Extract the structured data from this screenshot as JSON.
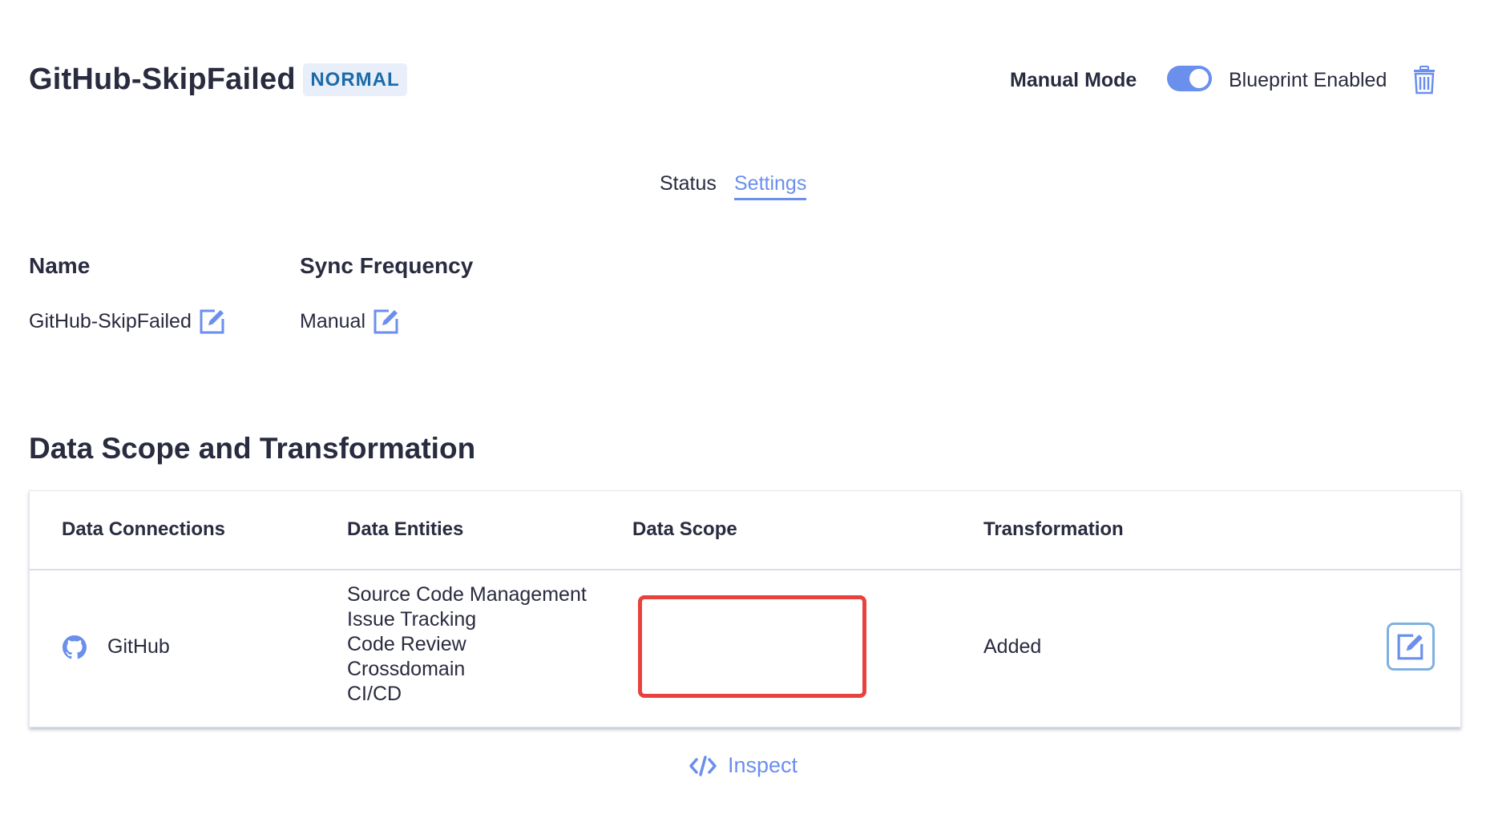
{
  "header": {
    "title": "GitHub-SkipFailed",
    "status_badge": "NORMAL",
    "manual_mode_label": "Manual Mode",
    "blueprint_toggle_on": true,
    "blueprint_label": "Blueprint Enabled"
  },
  "tabs": [
    {
      "label": "Status",
      "active": false
    },
    {
      "label": "Settings",
      "active": true
    }
  ],
  "settings": {
    "name_label": "Name",
    "name_value": "GitHub-SkipFailed",
    "sync_label": "Sync Frequency",
    "sync_value": "Manual"
  },
  "section": {
    "title": "Data Scope and Transformation"
  },
  "table": {
    "headers": [
      "Data Connections",
      "Data Entities",
      "Data Scope",
      "Transformation"
    ],
    "rows": [
      {
        "connection": "GitHub",
        "connection_icon": "github-icon",
        "entities": [
          "Source Code Management",
          "Issue Tracking",
          "Code Review",
          "Crossdomain",
          "CI/CD"
        ],
        "data_scope": "",
        "transformation": "Added"
      }
    ]
  },
  "inspect": {
    "label": "Inspect"
  },
  "colors": {
    "accent": "#6a8fec",
    "badge_bg": "#e8eefa",
    "badge_text": "#1c6aa8",
    "highlight": "#e8423f",
    "text": "#292b3f"
  }
}
